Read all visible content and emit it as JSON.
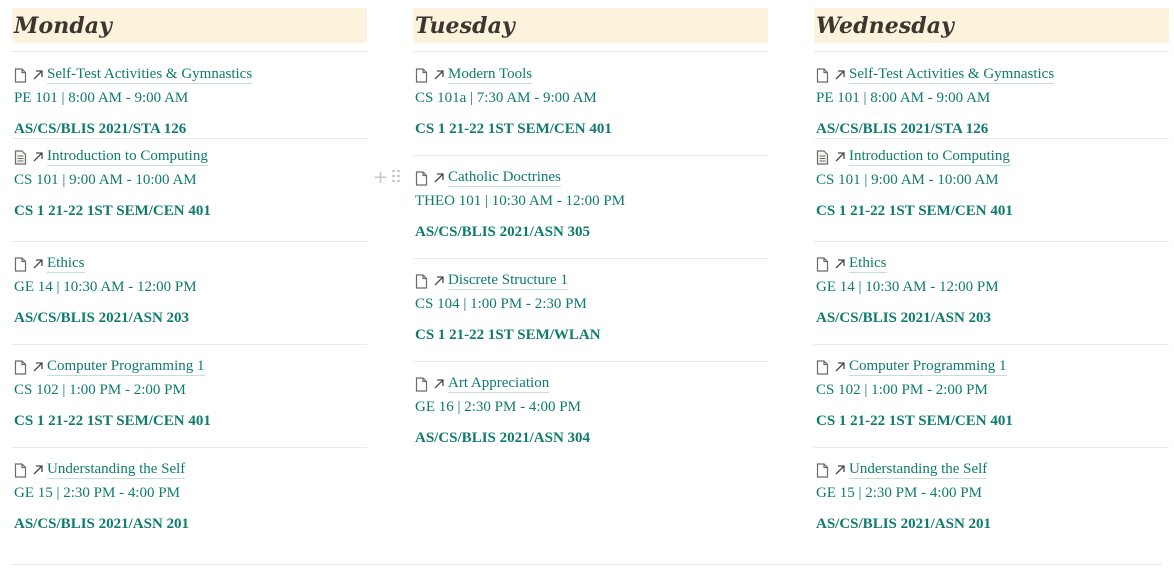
{
  "days": [
    {
      "name": "Monday",
      "courses": [
        {
          "title": "Self-Test Activities & Gymnastics",
          "schedule": "PE 101 | 8:00 AM - 9:00 AM",
          "room": "AS/CS/BLIS 2021/STA 126",
          "icon": "page-icon"
        },
        {
          "title": "Introduction to Computing",
          "schedule": "CS 101 | 9:00 AM - 10:00 AM",
          "room": "CS 1 21-22 1ST SEM/CEN 401",
          "icon": "page-text-icon"
        },
        {
          "title": "Ethics",
          "schedule": "GE 14 | 10:30 AM - 12:00 PM",
          "room": "AS/CS/BLIS 2021/ASN 203",
          "icon": "page-icon"
        },
        {
          "title": "Computer Programming 1",
          "schedule": "CS 102 | 1:00 PM - 2:00 PM",
          "room": "CS 1 21-22 1ST SEM/CEN 401",
          "icon": "page-icon"
        },
        {
          "title": "Understanding the Self",
          "schedule": "GE 15 | 2:30 PM - 4:00 PM",
          "room": "AS/CS/BLIS 2021/ASN 201",
          "icon": "page-icon"
        }
      ]
    },
    {
      "name": "Tuesday",
      "courses": [
        {
          "title": "Modern Tools",
          "schedule": "CS 101a | 7:30 AM - 9:00 AM",
          "room": "CS 1 21-22 1ST SEM/CEN 401",
          "icon": "page-icon"
        },
        {
          "title": "Catholic Doctrines",
          "schedule": "THEO 101 | 10:30 AM - 12:00 PM",
          "room": "AS/CS/BLIS 2021/ASN 305",
          "icon": "page-icon"
        },
        {
          "title": "Discrete Structure 1",
          "schedule": "CS 104 | 1:00 PM - 2:30  PM",
          "room": "CS 1 21-22 1ST SEM/WLAN",
          "icon": "page-icon"
        },
        {
          "title": "Art Appreciation",
          "schedule": "GE 16 | 2:30 PM - 4:00 PM",
          "room": "AS/CS/BLIS 2021/ASN 304",
          "icon": "page-icon"
        }
      ]
    },
    {
      "name": "Wednesday",
      "courses": [
        {
          "title": "Self-Test Activities & Gymnastics",
          "schedule": "PE 101 | 8:00 AM - 9:00 AM",
          "room": "AS/CS/BLIS 2021/STA 126",
          "icon": "page-icon"
        },
        {
          "title": "Introduction to Computing",
          "schedule": "CS 101 | 9:00 AM - 10:00 AM",
          "room": "CS 1 21-22 1ST SEM/CEN 401",
          "icon": "page-text-icon"
        },
        {
          "title": "Ethics",
          "schedule": "GE 14 | 10:30 AM - 12:00 PM",
          "room": "AS/CS/BLIS 2021/ASN 203",
          "icon": "page-icon"
        },
        {
          "title": "Computer Programming 1",
          "schedule": "CS 102 | 1:00 PM - 2:00 PM",
          "room": "CS 1 21-22 1ST SEM/CEN 401",
          "icon": "page-icon"
        },
        {
          "title": "Understanding the Self",
          "schedule": "GE 15 | 2:30 PM - 4:00 PM",
          "room": "AS/CS/BLIS 2021/ASN 201",
          "icon": "page-icon"
        }
      ]
    }
  ],
  "colors": {
    "accent": "#0f7b6c",
    "header_bg": "#fbf3db",
    "divider": "#ebeae7"
  }
}
